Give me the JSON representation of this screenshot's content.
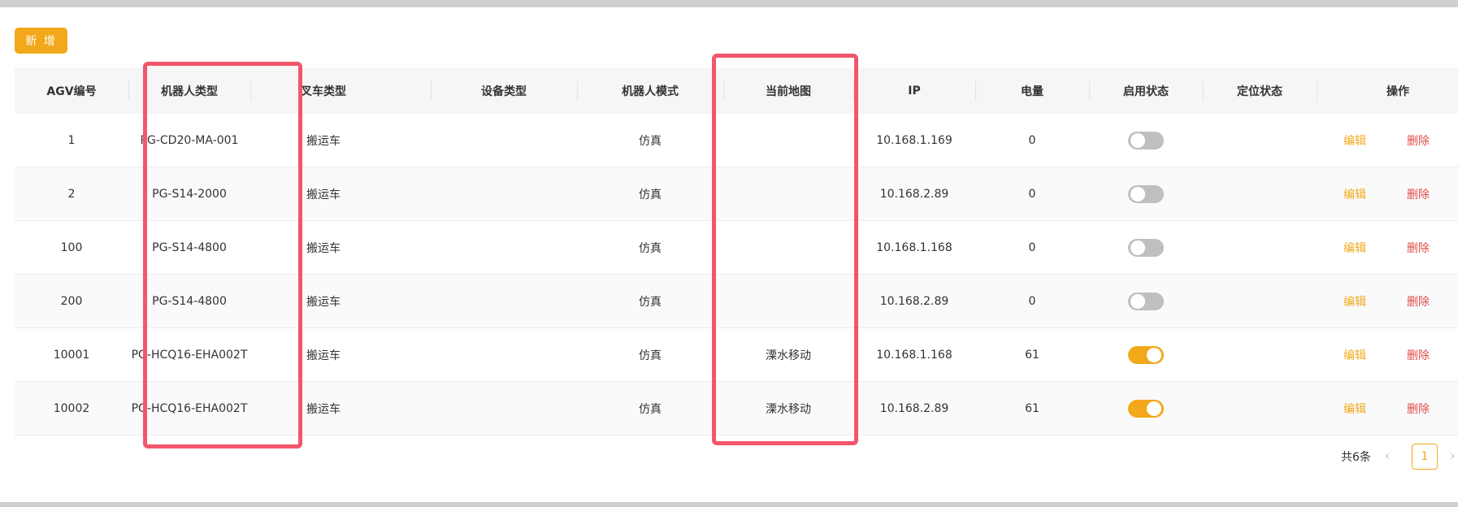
{
  "toolbar": {
    "add_label": "新 增"
  },
  "table": {
    "headers": [
      "AGV编号",
      "机器人类型",
      "叉车类型",
      "设备类型",
      "机器人模式",
      "当前地图",
      "IP",
      "电量",
      "启用状态",
      "定位状态",
      "操作"
    ],
    "rows": [
      {
        "agv": "1",
        "robot_type": "PG-CD20-MA-001",
        "forklift_type": "搬运车",
        "device_type": "",
        "mode": "仿真",
        "map": "",
        "ip": "10.168.1.169",
        "battery": "0",
        "enabled": false,
        "positioning": "",
        "edit": "编辑",
        "delete": "删除"
      },
      {
        "agv": "2",
        "robot_type": "PG-S14-2000",
        "forklift_type": "搬运车",
        "device_type": "",
        "mode": "仿真",
        "map": "",
        "ip": "10.168.2.89",
        "battery": "0",
        "enabled": false,
        "positioning": "",
        "edit": "编辑",
        "delete": "删除"
      },
      {
        "agv": "100",
        "robot_type": "PG-S14-4800",
        "forklift_type": "搬运车",
        "device_type": "",
        "mode": "仿真",
        "map": "",
        "ip": "10.168.1.168",
        "battery": "0",
        "enabled": false,
        "positioning": "",
        "edit": "编辑",
        "delete": "删除"
      },
      {
        "agv": "200",
        "robot_type": "PG-S14-4800",
        "forklift_type": "搬运车",
        "device_type": "",
        "mode": "仿真",
        "map": "",
        "ip": "10.168.2.89",
        "battery": "0",
        "enabled": false,
        "positioning": "",
        "edit": "编辑",
        "delete": "删除"
      },
      {
        "agv": "10001",
        "robot_type": "PG-HCQ16-EHA002T",
        "forklift_type": "搬运车",
        "device_type": "",
        "mode": "仿真",
        "map": "溧水移动",
        "ip": "10.168.1.168",
        "battery": "61",
        "enabled": true,
        "positioning": "",
        "edit": "编辑",
        "delete": "删除"
      },
      {
        "agv": "10002",
        "robot_type": "PG-HCQ16-EHA002T",
        "forklift_type": "搬运车",
        "device_type": "",
        "mode": "仿真",
        "map": "溧水移动",
        "ip": "10.168.2.89",
        "battery": "61",
        "enabled": true,
        "positioning": "",
        "edit": "编辑",
        "delete": "删除"
      }
    ]
  },
  "pagination": {
    "total_label": "共6条",
    "prev_icon": "‹",
    "current_page": "1",
    "next_icon": "›"
  },
  "colors": {
    "accent": "#f2a81a",
    "danger": "#e24a4a",
    "highlight": "#f2566b"
  }
}
